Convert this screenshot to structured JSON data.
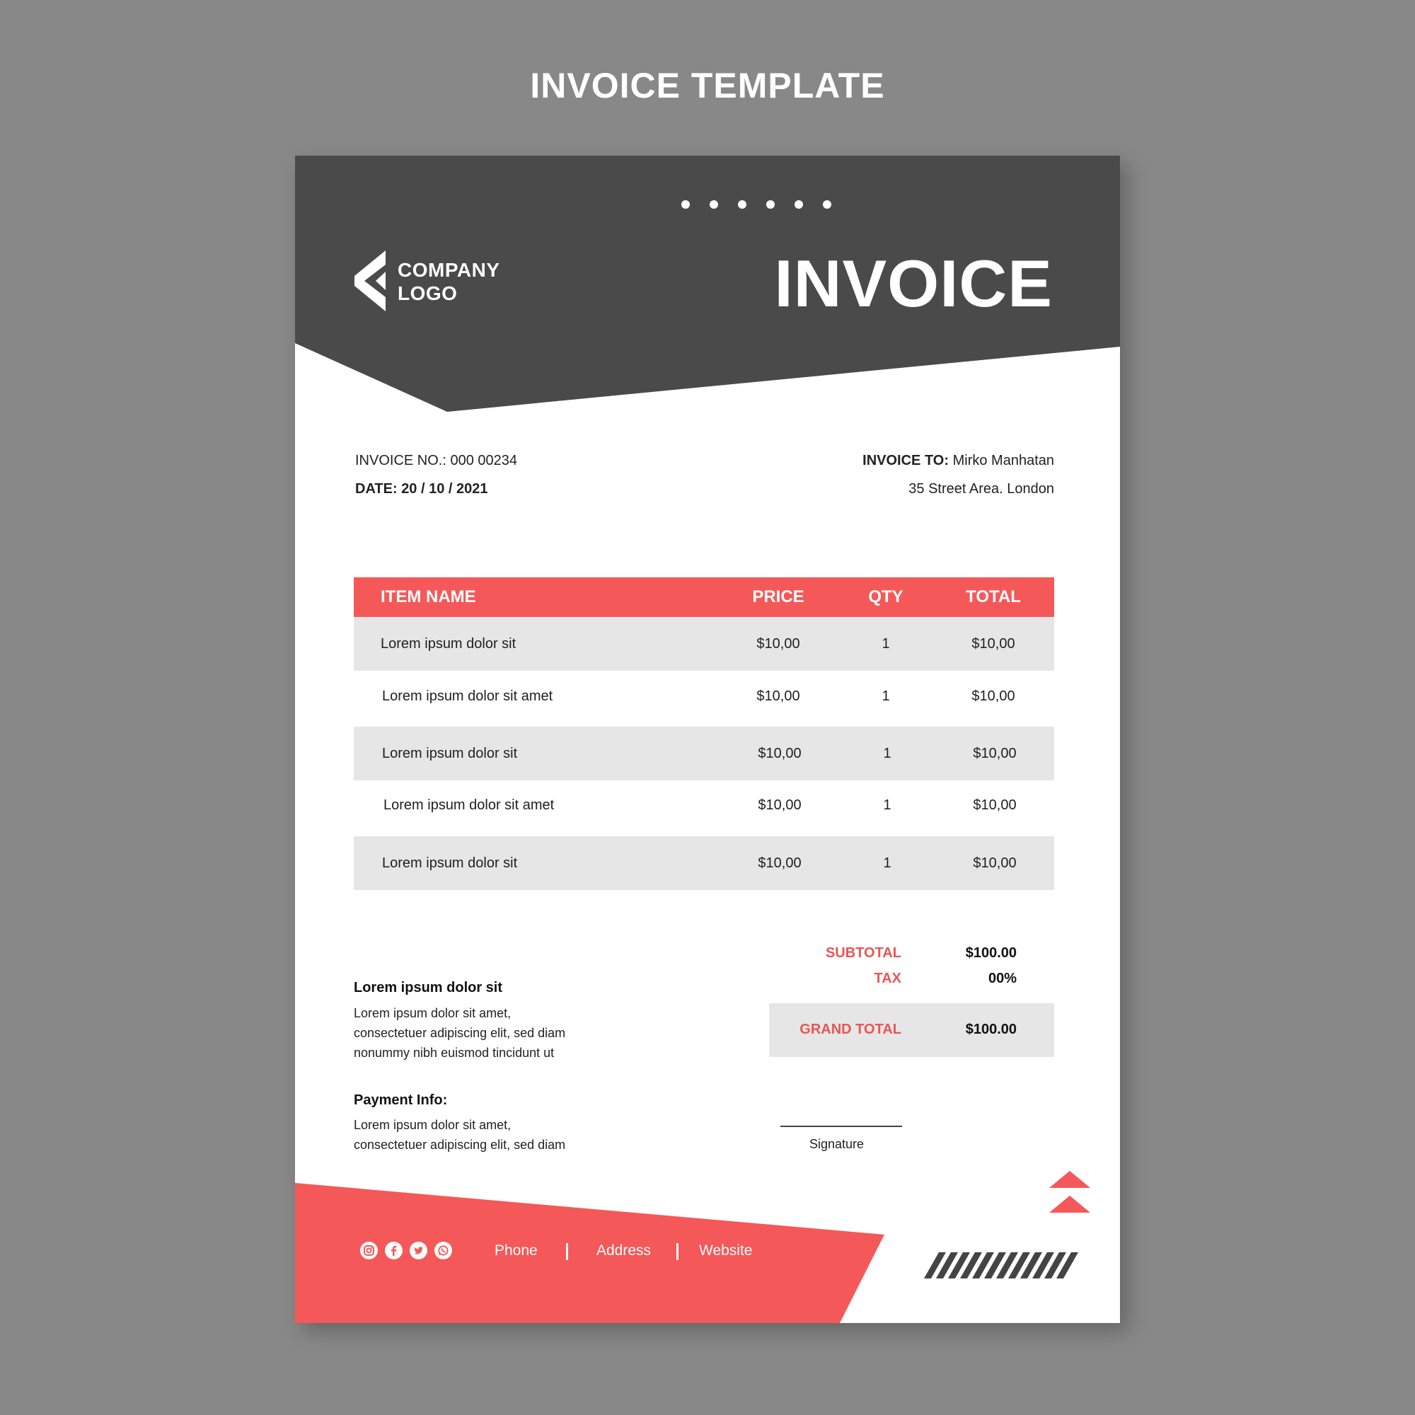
{
  "page": {
    "heading": "INVOICE TEMPLATE"
  },
  "colors": {
    "background": "#888888",
    "header": "#4a4a4a",
    "accent": "#f55858",
    "row_shade": "#e6e6e6"
  },
  "company": {
    "logo_line1": "COMPANY",
    "logo_line2": "LOGO",
    "logo_icon": "chevron-logo-icon"
  },
  "title": "INVOICE",
  "meta": {
    "invoice_no_label": "INVOICE NO.:",
    "invoice_no_value": "000 00234",
    "date_label": "DATE:",
    "date_value": "20 / 10 / 2021",
    "invoice_to_label": "INVOICE TO:",
    "invoice_to_name": "Mirko Manhatan",
    "invoice_to_address": "35 Street Area. London"
  },
  "table": {
    "headers": {
      "item": "ITEM NAME",
      "price": "PRICE",
      "qty": "QTY",
      "total": "TOTAL"
    },
    "rows": [
      {
        "item": "Lorem ipsum dolor sit",
        "price": "$10,00",
        "qty": "1",
        "total": "$10,00"
      },
      {
        "item": "Lorem ipsum dolor sit amet",
        "price": "$10,00",
        "qty": "1",
        "total": "$10,00"
      },
      {
        "item": "Lorem ipsum dolor sit",
        "price": "$10,00",
        "qty": "1",
        "total": "$10,00"
      },
      {
        "item": "Lorem ipsum dolor sit amet",
        "price": "$10,00",
        "qty": "1",
        "total": "$10,00"
      },
      {
        "item": "Lorem ipsum dolor sit",
        "price": "$10,00",
        "qty": "1",
        "total": "$10,00"
      }
    ]
  },
  "totals": {
    "subtotal_label": "SUBTOTAL",
    "subtotal_value": "$100.00",
    "tax_label": "TAX",
    "tax_value": "00%",
    "grand_label": "GRAND TOTAL",
    "grand_value": "$100.00"
  },
  "notes": {
    "heading": "Lorem ipsum dolor sit",
    "line1": "Lorem ipsum dolor sit amet,",
    "line2": "consectetuer adipiscing elit, sed diam",
    "line3": "nonummy nibh euismod tincidunt ut"
  },
  "payment": {
    "heading": "Payment Info:",
    "line1": "Lorem ipsum dolor sit amet,",
    "line2": "consectetuer adipiscing elit, sed diam"
  },
  "signature": {
    "label": "Signature"
  },
  "footer": {
    "social_icons": [
      "instagram-icon",
      "facebook-icon",
      "twitter-icon",
      "whatsapp-icon"
    ],
    "phone": "Phone",
    "address": "Address",
    "website": "Website"
  }
}
